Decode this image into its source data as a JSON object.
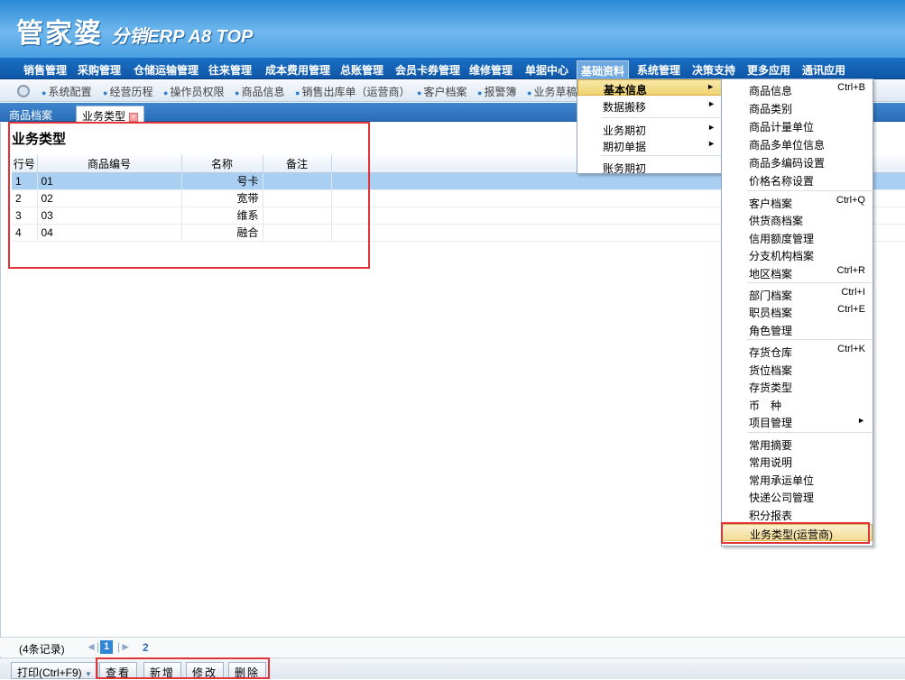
{
  "header": {
    "logo_main": "管家婆",
    "logo_sub": "分销ERP A8 TOP"
  },
  "menubar": [
    {
      "label": "销售管理",
      "active": false
    },
    {
      "label": "采购管理",
      "active": false
    },
    {
      "label": "仓储运输管理",
      "active": false
    },
    {
      "label": "往来管理",
      "active": false
    },
    {
      "label": "成本费用管理",
      "active": false
    },
    {
      "label": "总账管理",
      "active": false
    },
    {
      "label": "会员卡券管理",
      "active": false
    },
    {
      "label": "维修管理",
      "active": false
    },
    {
      "label": "单据中心",
      "active": false
    },
    {
      "label": "基础资料",
      "active": true
    },
    {
      "label": "系统管理",
      "active": false
    },
    {
      "label": "决策支持",
      "active": false
    },
    {
      "label": "更多应用",
      "active": false
    },
    {
      "label": "通讯应用",
      "active": false
    }
  ],
  "quickbar": [
    "系统配置",
    "经营历程",
    "操作员权限",
    "商品信息",
    "销售出库单（运营商）",
    "客户档案",
    "报警簿",
    "业务草稿"
  ],
  "tabs": [
    {
      "label": "商品档案",
      "active": false
    },
    {
      "label": "业务类型",
      "active": true
    }
  ],
  "page": {
    "title": "业务类型",
    "columns": [
      "行号",
      "商品编号",
      "名称",
      "备注"
    ],
    "rows": [
      {
        "no": "1",
        "code": "01",
        "name": "号卡",
        "note": ""
      },
      {
        "no": "2",
        "code": "02",
        "name": "宽带",
        "note": ""
      },
      {
        "no": "3",
        "code": "03",
        "name": "维系",
        "note": ""
      },
      {
        "no": "4",
        "code": "04",
        "name": "融合",
        "note": ""
      }
    ]
  },
  "pager": {
    "count": "(4条记录)",
    "current_page": "1",
    "next_page": "2"
  },
  "actions": {
    "print": "打印(Ctrl+F9)",
    "view": "查看",
    "add": "新增",
    "edit": "修改",
    "delete": "删除"
  },
  "menu_level1": [
    {
      "label": "基本信息",
      "submenu": true,
      "highlighted": true
    },
    {
      "label": "数据搬移",
      "submenu": true
    },
    {
      "label": "业务期初",
      "submenu": true
    },
    {
      "label": "期初单据",
      "submenu": true
    },
    {
      "label": "账务期初",
      "submenu": false
    }
  ],
  "menu_level2": [
    {
      "label": "商品信息",
      "shortcut": "Ctrl+B"
    },
    {
      "label": "商品类别",
      "shortcut": ""
    },
    {
      "label": "商品计量单位",
      "shortcut": ""
    },
    {
      "label": "商品多单位信息",
      "shortcut": ""
    },
    {
      "label": "商品多编码设置",
      "shortcut": ""
    },
    {
      "label": "价格名称设置",
      "shortcut": ""
    },
    {
      "label": "客户档案",
      "shortcut": "Ctrl+Q"
    },
    {
      "label": "供货商档案",
      "shortcut": ""
    },
    {
      "label": "信用额度管理",
      "shortcut": ""
    },
    {
      "label": "分支机构档案",
      "shortcut": ""
    },
    {
      "label": "地区档案",
      "shortcut": "Ctrl+R"
    },
    {
      "label": "部门档案",
      "shortcut": "Ctrl+I"
    },
    {
      "label": "职员档案",
      "shortcut": "Ctrl+E"
    },
    {
      "label": "角色管理",
      "shortcut": ""
    },
    {
      "label": "存货仓库",
      "shortcut": "Ctrl+K"
    },
    {
      "label": "货位档案",
      "shortcut": ""
    },
    {
      "label": "存货类型",
      "shortcut": ""
    },
    {
      "label": "币　种",
      "shortcut": ""
    },
    {
      "label": "项目管理",
      "shortcut": ""
    },
    {
      "label": "常用摘要",
      "shortcut": ""
    },
    {
      "label": "常用说明",
      "shortcut": ""
    },
    {
      "label": "常用承运单位",
      "shortcut": ""
    },
    {
      "label": "快递公司管理",
      "shortcut": ""
    },
    {
      "label": "积分报表",
      "shortcut": ""
    },
    {
      "label": "业务类型(运营商)",
      "shortcut": ""
    }
  ]
}
